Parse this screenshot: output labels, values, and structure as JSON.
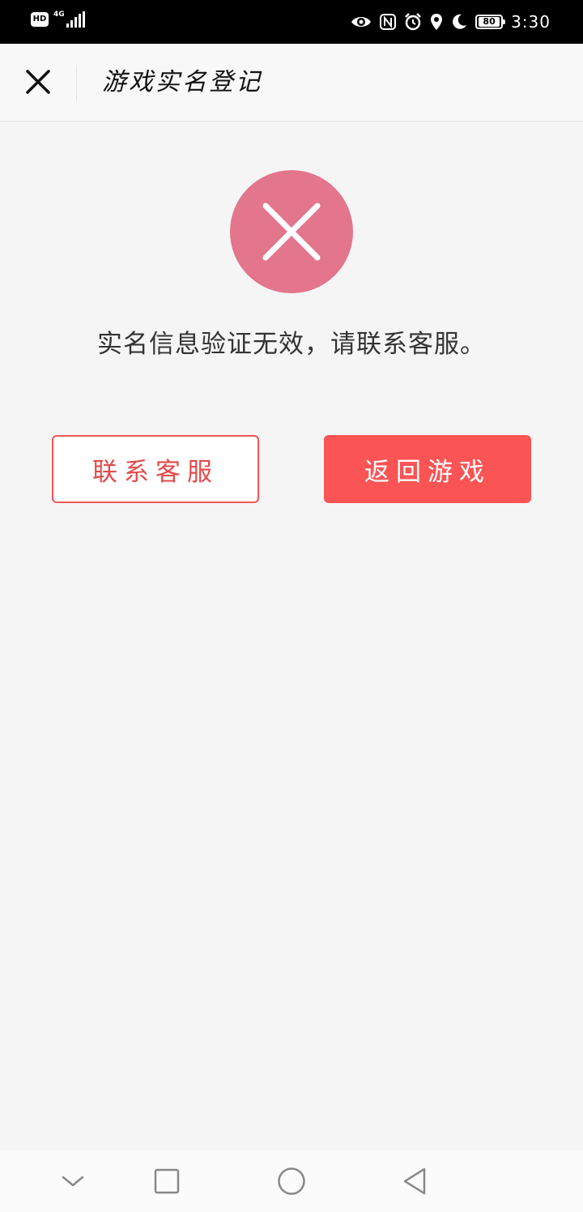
{
  "status_bar": {
    "hd_badge": "HD",
    "network": "4G",
    "battery_level": "80",
    "time": "3:30",
    "icons": [
      "eye-icon",
      "nfc-icon",
      "alarm-icon",
      "location-icon",
      "moon-icon",
      "battery-icon"
    ]
  },
  "header": {
    "title": "游戏实名登记",
    "close_icon": "close-icon"
  },
  "result": {
    "icon": "error-x-icon",
    "icon_color": "#e3758c",
    "message": "实名信息验证无效，请联系客服。"
  },
  "actions": {
    "contact_label": "联系客服",
    "return_label": "返回游戏",
    "accent_color": "#fb5454"
  },
  "nav_bar": {
    "icons": [
      "collapse-icon",
      "recent-apps-icon",
      "home-icon",
      "back-icon"
    ]
  }
}
